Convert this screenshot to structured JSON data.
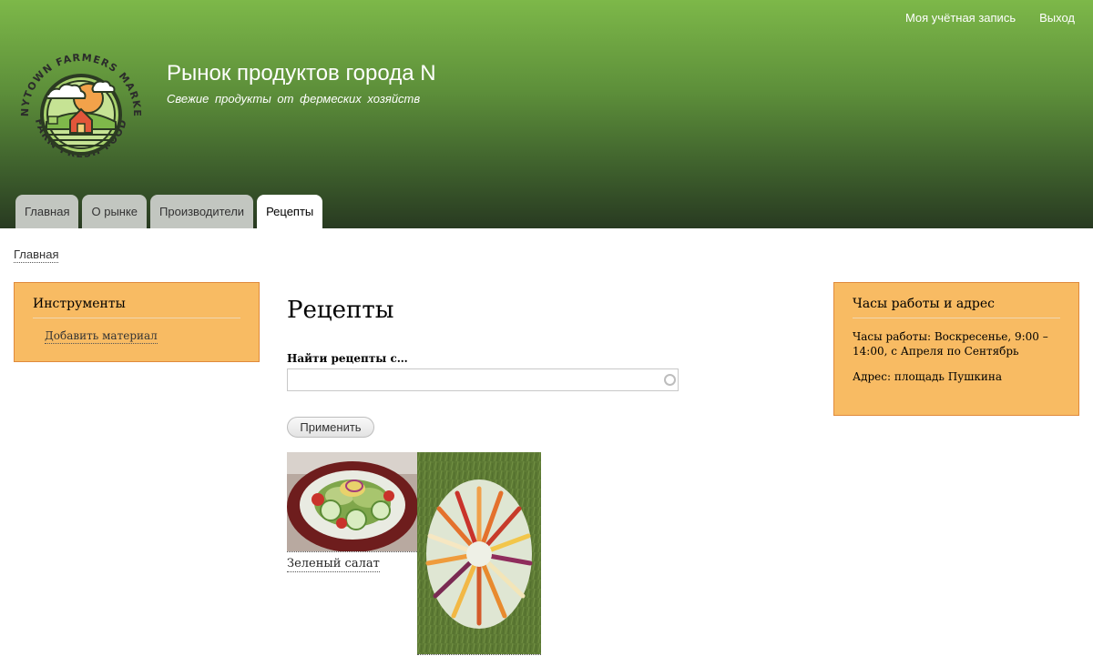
{
  "header": {
    "site_name": "Рынок продуктов города N",
    "slogan": "Свежие продукты от фермеских хозяйств",
    "logo": {
      "top_text": "ANYTOWN FARMERS MARKET",
      "bottom_text": "FARM FRESH FOOD"
    },
    "secondary_menu": [
      {
        "label": "Моя учётная запись"
      },
      {
        "label": "Выход"
      }
    ],
    "main_menu": [
      {
        "label": "Главная",
        "active": false
      },
      {
        "label": "О рынке",
        "active": false
      },
      {
        "label": "Производители",
        "active": false
      },
      {
        "label": "Рецепты",
        "active": true
      }
    ]
  },
  "breadcrumb": {
    "label": "Главная"
  },
  "sidebar_left": {
    "title": "Инструменты",
    "link": "Добавить материал"
  },
  "sidebar_right": {
    "title": "Часы работы и адрес",
    "hours": "Часы работы: Воскресенье, 9:00 – 14:00, с Апреля по Сентябрь",
    "address": "Адрес: площадь Пушкина"
  },
  "main": {
    "title": "Рецепты",
    "search": {
      "label": "Найти рецепты с…",
      "value": "",
      "placeholder": ""
    },
    "apply_label": "Применить",
    "recipes": [
      {
        "title": "Зеленый салат",
        "image": "salad-photo"
      },
      {
        "title": "",
        "image": "carrots-photo"
      }
    ]
  },
  "colors": {
    "header_top": "#7db849",
    "header_bottom": "#283a21",
    "block_bg": "#f8bb63",
    "block_border": "#e08a3c",
    "tab_bg": "#c2c6c0"
  }
}
